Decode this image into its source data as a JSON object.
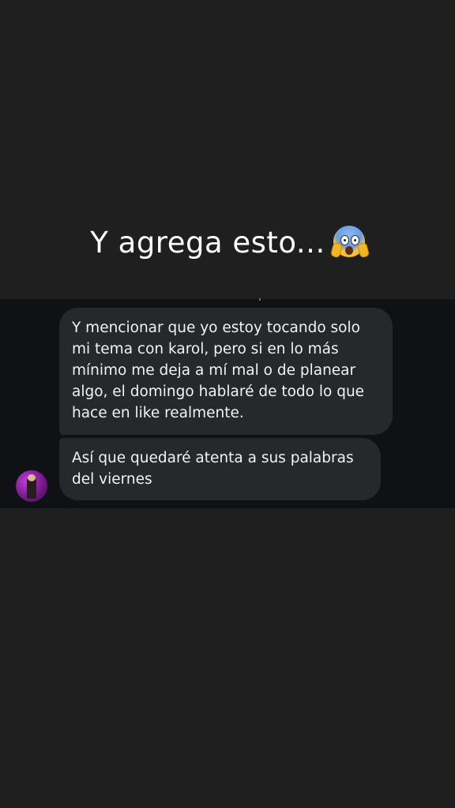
{
  "story": {
    "caption": "Y agrega esto...",
    "caption_emoji": "face-screaming-in-fear-emoji"
  },
  "messages": [
    {
      "text": "Y mencionar que yo estoy tocando solo\nmi tema con karol, pero si en lo más\nmínimo me deja a mí mal o de planear\nalgo, el domingo hablaré de todo lo que\nhace en like realmente."
    },
    {
      "text": "Así que quedaré atenta a sus palabras\ndel viernes"
    }
  ],
  "colors": {
    "background": "#1f1f1f",
    "chat_strip": "#0f1114",
    "bubble": "#26282c",
    "text": "#f2f2f2"
  }
}
